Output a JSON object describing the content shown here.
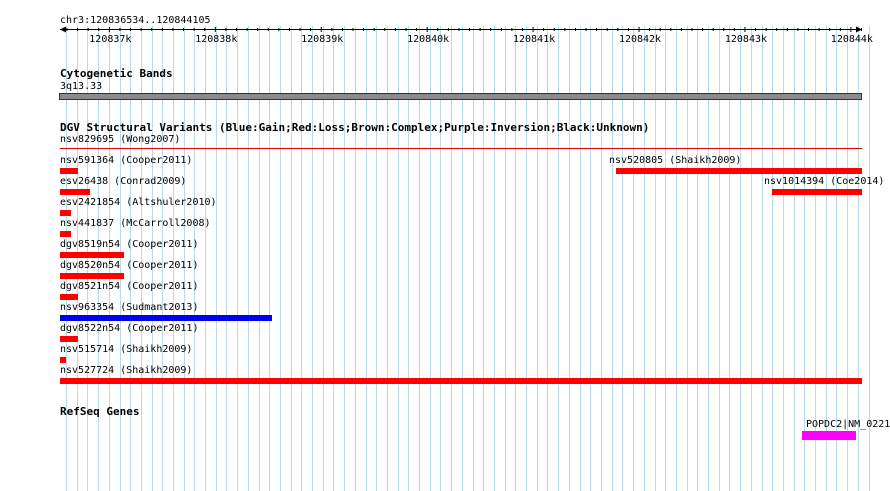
{
  "location": "chr3:120836534..120844105",
  "ruler": {
    "ticks": [
      "120837k",
      "120838k",
      "120839k",
      "120840k",
      "120841k",
      "120842k",
      "120843k",
      "120844k"
    ]
  },
  "cytoband": {
    "title": "Cytogenetic Bands",
    "band": "3q13.33"
  },
  "dgv": {
    "title": "DGV Structural Variants (Blue:Gain;Red:Loss;Brown:Complex;Purple:Inversion;Black:Unknown)",
    "line_color": "#e00000",
    "variants": [
      {
        "label": "nsv829695 (Wong2007)",
        "type": "loss",
        "color": "#ff0000",
        "bp_start": null,
        "bp_end": null
      },
      {
        "label": "nsv591364 (Cooper2011)",
        "type": "loss",
        "color": "#ff0000",
        "bp_start": 120836534,
        "bp_end": 120836700
      },
      {
        "label": "nsv520805 (Shaikh2009)",
        "type": "loss",
        "color": "#ff0000",
        "bp_start": 120841780,
        "bp_end": 120844105
      },
      {
        "label": "esv26438 (Conrad2009)",
        "type": "loss",
        "color": "#ff0000",
        "bp_start": 120836534,
        "bp_end": 120836820
      },
      {
        "label": "nsv1014394 (Coe2014)",
        "type": "loss",
        "color": "#ff0000",
        "bp_start": 120843260,
        "bp_end": 120844105
      },
      {
        "label": "esv2421854 (Altshuler2010)",
        "type": "loss",
        "color": "#ff0000",
        "bp_start": 120836534,
        "bp_end": 120836640
      },
      {
        "label": "nsv441837 (McCarroll2008)",
        "type": "loss",
        "color": "#ff0000",
        "bp_start": 120836534,
        "bp_end": 120836640
      },
      {
        "label": "dgv8519n54 (Cooper2011)",
        "type": "loss",
        "color": "#ff0000",
        "bp_start": 120836534,
        "bp_end": 120837140
      },
      {
        "label": "dgv8520n54 (Cooper2011)",
        "type": "loss",
        "color": "#ff0000",
        "bp_start": 120836534,
        "bp_end": 120837140
      },
      {
        "label": "dgv8521n54 (Cooper2011)",
        "type": "loss",
        "color": "#ff0000",
        "bp_start": 120836534,
        "bp_end": 120836700
      },
      {
        "label": "nsv963354 (Sudmant2013)",
        "type": "gain",
        "color": "#0000ee",
        "bp_start": 120836534,
        "bp_end": 120838540
      },
      {
        "label": "dgv8522n54 (Cooper2011)",
        "type": "loss",
        "color": "#ff0000",
        "bp_start": 120836534,
        "bp_end": 120836700
      },
      {
        "label": "nsv515714 (Shaikh2009)",
        "type": "loss",
        "color": "#ff0000",
        "bp_start": 120836534,
        "bp_end": 120836590
      },
      {
        "label": "nsv527724 (Shaikh2009)",
        "type": "loss",
        "color": "#ff0000",
        "bp_start": 120836534,
        "bp_end": 120844105
      }
    ]
  },
  "refseq": {
    "title": "RefSeq Genes",
    "genes": [
      {
        "label": "POPDC2|NM_0221",
        "color": "#ff00ff",
        "bp_start": 120843540,
        "bp_end": 120844050
      }
    ]
  },
  "colors": {
    "grid": "#b7dbe9",
    "band": "#8c8c8c",
    "gain": "#0000ee",
    "loss": "#ff0000",
    "gene": "#ff00ff"
  }
}
